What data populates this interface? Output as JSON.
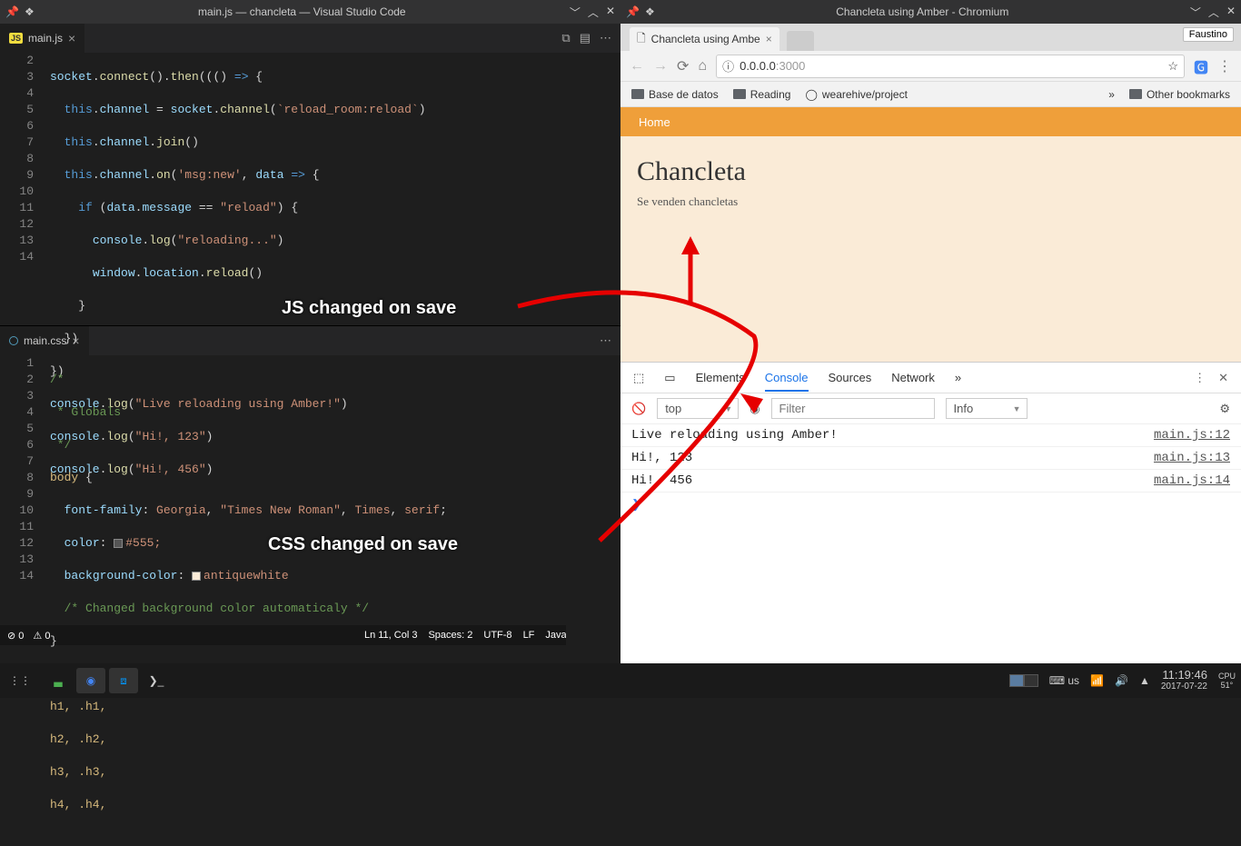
{
  "vscode": {
    "title": "main.js — chancleta — Visual Studio Code",
    "tab_js": "main.js",
    "tab_css": "main.css",
    "js_lines": [
      2,
      3,
      4,
      5,
      6,
      7,
      8,
      9,
      10,
      11,
      12,
      13,
      14
    ],
    "css_lines": [
      1,
      2,
      3,
      4,
      5,
      6,
      7,
      8,
      9,
      10,
      11,
      12,
      13,
      14
    ],
    "status": {
      "errors": "0",
      "warnings": "0",
      "line_col": "Ln 11, Col 3",
      "spaces": "Spaces: 2",
      "encoding": "UTF-8",
      "eol": "LF",
      "lang": "JavaScript"
    },
    "code_js": {
      "l2": "socket.connect().then(() => {",
      "l3": "  this.channel = socket.channel(`reload_room:reload`)",
      "l4": "  this.channel.join()",
      "l5": "  this.channel.on('msg:new', data => {",
      "l6": "    if (data.message == \"reload\") {",
      "l7": "      console.log(\"reloading...\")",
      "l8": "      window.location.reload()",
      "l9": "    }",
      "l10": "  })",
      "l11": "})",
      "l12": "console.log(\"Live reloading using Amber!\")",
      "l13": "console.log(\"Hi!, 123\")",
      "l14": "console.log(\"Hi!, 456\")"
    },
    "code_css": {
      "l1": "/*",
      "l2": " * Globals",
      "l3": " */",
      "l4_sel": "body",
      "l5_prop": "font-family",
      "l5_val": "Georgia, \"Times New Roman\", Times, serif;",
      "l6_prop": "color",
      "l6_val": "#555;",
      "l7_prop": "background-color",
      "l7_val": "antiquewhite",
      "l8": "/* Changed background color automaticaly */",
      "l11": "h1, .h1,",
      "l12": "h2, .h2,",
      "l13": "h3, .h3,",
      "l14": "h4, .h4,"
    }
  },
  "chrome": {
    "title": "Chancleta using Amber - Chromium",
    "tab_title": "Chancleta using Ambe",
    "user": "Faustino",
    "url_host": "0.0.0.0",
    "url_port": ":3000",
    "bookmarks": {
      "b1": "Base de datos",
      "b2": "Reading",
      "b3": "wearehive/project",
      "other": "Other bookmarks"
    },
    "page": {
      "nav_home": "Home",
      "heading": "Chancleta",
      "sub": "Se venden chancletas"
    },
    "devtools": {
      "tabs": {
        "elements": "Elements",
        "console": "Console",
        "sources": "Sources",
        "network": "Network"
      },
      "filter_context": "top",
      "filter_placeholder": "Filter",
      "level": "Info",
      "console": [
        {
          "msg": "Live reloading using Amber!",
          "src": "main.js:12"
        },
        {
          "msg": "Hi!, 123",
          "src": "main.js:13"
        },
        {
          "msg": "Hi!, 456",
          "src": "main.js:14"
        }
      ]
    }
  },
  "annotations": {
    "js": "JS changed on save",
    "css": "CSS changed on save"
  },
  "taskbar": {
    "kb_layout": "us",
    "time": "11:19:46",
    "date": "2017-07-22",
    "cpu_label": "CPU",
    "cpu_temp": "51°"
  }
}
